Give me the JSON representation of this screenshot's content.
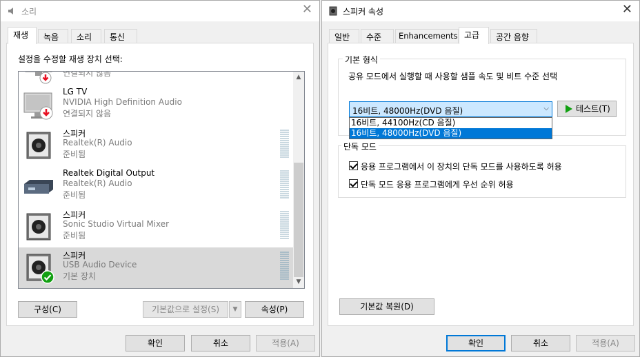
{
  "left_dialog": {
    "title": "소리",
    "tabs": [
      "재생",
      "녹음",
      "소리",
      "통신"
    ],
    "instruction": "설정을 수정할 재생 장치 선택:",
    "devices": [
      {
        "name": "",
        "desc": "",
        "status": "연결되지 않음",
        "icon": "monitor-icon",
        "badge": "disconnected-badge-icon"
      },
      {
        "name": "LG TV",
        "desc": "NVIDIA High Definition Audio",
        "status": "연결되지 않음",
        "icon": "monitor-icon",
        "badge": "disconnected-badge-icon"
      },
      {
        "name": "스피커",
        "desc": "Realtek(R) Audio",
        "status": "준비됨",
        "icon": "speaker-icon",
        "badge": ""
      },
      {
        "name": "Realtek Digital Output",
        "desc": "Realtek(R) Audio",
        "status": "준비됨",
        "icon": "digital-output-icon",
        "badge": ""
      },
      {
        "name": "스피커",
        "desc": "Sonic Studio Virtual Mixer",
        "status": "준비됨",
        "icon": "speaker-icon",
        "badge": ""
      },
      {
        "name": "스피커",
        "desc": "USB Audio Device",
        "status": "기본 장치",
        "icon": "speaker-icon",
        "badge": "default-check-icon"
      }
    ],
    "buttons": {
      "configure": "구성(C)",
      "set_default": "기본값으로 설정(S)",
      "properties": "속성(P)",
      "ok": "확인",
      "cancel": "취소",
      "apply": "적용(A)"
    }
  },
  "right_dialog": {
    "title": "스피커 속성",
    "tabs": [
      "일반",
      "수준",
      "Enhancements",
      "고급",
      "공간 음향"
    ],
    "active_tab": "고급",
    "default_format": {
      "group_label": "기본 형식",
      "description": "공유 모드에서 실행할 때 사용할 샘플 속도 및 비트 수준 선택",
      "selected": "16비트, 48000Hz(DVD 음질)",
      "options": [
        "16비트, 44100Hz(CD 음질)",
        "16비트, 48000Hz(DVD 음질)"
      ],
      "test_button": "테스트(T)"
    },
    "exclusive_mode": {
      "group_label": "단독 모드",
      "allow_exclusive": "응용 프로그램에서 이 장치의 단독 모드를 사용하도록 허용",
      "give_priority": "단독 모드 응용 프로그램에게 우선 순위 허용",
      "allow_exclusive_checked": true,
      "give_priority_checked": true
    },
    "restore_defaults": "기본값 복원(D)",
    "buttons": {
      "ok": "확인",
      "cancel": "취소",
      "apply": "적용(A)"
    }
  },
  "colors": {
    "accent": "#0078d7",
    "selected_row": "#d9d9d9",
    "combo_bg": "#cce8ff",
    "test_play": "#12a012"
  }
}
